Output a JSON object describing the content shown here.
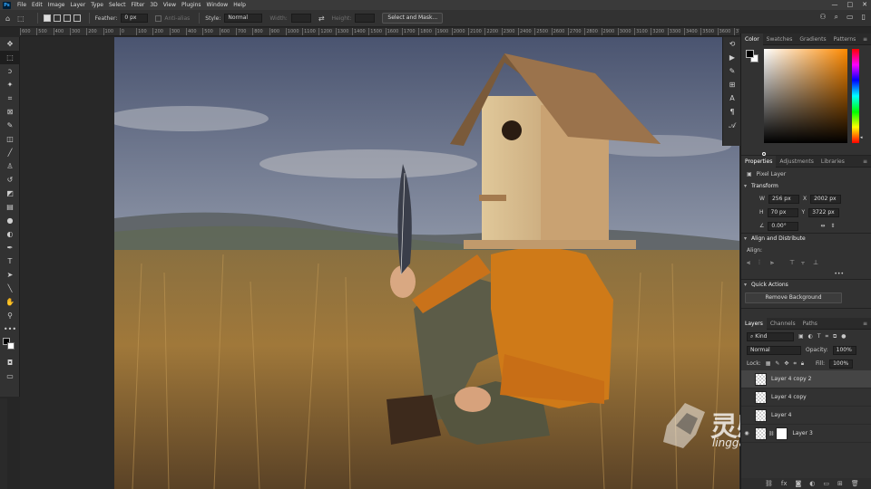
{
  "app": {
    "logo_text": "Ps"
  },
  "menu": [
    "File",
    "Edit",
    "Image",
    "Layer",
    "Type",
    "Select",
    "Filter",
    "3D",
    "View",
    "Plugins",
    "Window",
    "Help"
  ],
  "options_bar": {
    "feather_label": "Feather:",
    "feather_value": "0 px",
    "anti_alias_label": "Anti-alias",
    "style_label": "Style:",
    "style_value": "Normal",
    "width_label": "Width:",
    "height_label": "Height:",
    "select_mask_label": "Select and Mask..."
  },
  "ruler": {
    "ticks": [
      "600",
      "500",
      "400",
      "300",
      "200",
      "100",
      "0",
      "100",
      "200",
      "300",
      "400",
      "500",
      "600",
      "700",
      "800",
      "900",
      "1000",
      "1100",
      "1200",
      "1300",
      "1400",
      "1500",
      "1600",
      "1700",
      "1800",
      "1900",
      "2000",
      "2100",
      "2200",
      "2300",
      "2400",
      "2500",
      "2600",
      "2700",
      "2800",
      "2900",
      "3000",
      "3100",
      "3200",
      "3300",
      "3400",
      "3500",
      "3600",
      "3700"
    ]
  },
  "color_panel": {
    "tabs": [
      "Color",
      "Swatches",
      "Gradients",
      "Patterns"
    ],
    "foreground": "#000000",
    "background": "#ffffff",
    "hue_color": "#ff8a00"
  },
  "properties_panel": {
    "tabs": [
      "Properties",
      "Adjustments",
      "Libraries"
    ],
    "layer_type": "Pixel Layer",
    "transform_title": "Transform",
    "w_label": "W",
    "w_value": "256 px",
    "h_label": "H",
    "h_value": "70 px",
    "x_label": "X",
    "x_value": "2002 px",
    "y_label": "Y",
    "y_value": "3722 px",
    "angle_value": "0.00°",
    "align_title": "Align and Distribute",
    "align_label": "Align:",
    "more": "•••",
    "quick_actions_title": "Quick Actions",
    "remove_bg_label": "Remove Background"
  },
  "layers_panel": {
    "tabs": [
      "Layers",
      "Channels",
      "Paths"
    ],
    "kind_label": "Kind",
    "blend_mode": "Normal",
    "opacity_label": "Opacity:",
    "opacity_value": "100%",
    "lock_label": "Lock:",
    "fill_label": "Fill:",
    "fill_value": "100%",
    "layers": [
      {
        "name": "Layer 4 copy 2",
        "selected": true
      },
      {
        "name": "Layer 4 copy",
        "selected": false
      },
      {
        "name": "Layer 4",
        "selected": false
      },
      {
        "name": "Layer 3",
        "selected": false
      }
    ],
    "bottom_icons": [
      "link-icon",
      "fx-icon",
      "mask-icon",
      "adjustment-icon",
      "folder-icon",
      "new-layer-icon",
      "trash-icon"
    ]
  },
  "watermark": {
    "text": "灵感中国",
    "sub": "lingganchina.com"
  }
}
